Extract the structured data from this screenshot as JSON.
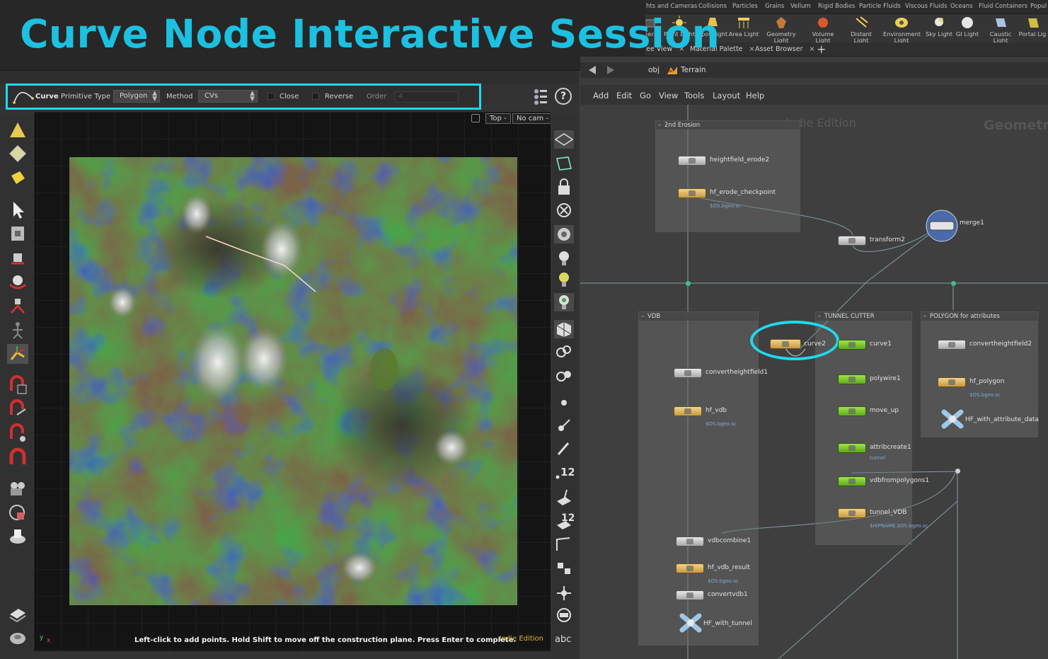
{
  "banner": {
    "title": "Curve Node Interactive Session"
  },
  "shelf": {
    "tabs": [
      "hts and Cameras",
      "Collisions",
      "Particles",
      "Grains",
      "Vellum",
      "Rigid Bodies",
      "Particle Fluids",
      "Viscous Fluids",
      "Oceans",
      "Fluid Containers",
      "Popul"
    ],
    "tools": [
      {
        "label": "mera",
        "icon": "camera-icon"
      },
      {
        "label": "Point Light",
        "icon": "point-light-icon"
      },
      {
        "label": "Spot Light",
        "icon": "spot-light-icon"
      },
      {
        "label": "Area Light",
        "icon": "area-light-icon"
      },
      {
        "label": "Geometry Light",
        "icon": "geometry-light-icon"
      },
      {
        "label": "Volume Light",
        "icon": "volume-light-icon"
      },
      {
        "label": "Distant Light",
        "icon": "distant-light-icon"
      },
      {
        "label": "Environment Light",
        "icon": "environment-light-icon"
      },
      {
        "label": "Sky Light",
        "icon": "sky-light-icon"
      },
      {
        "label": "GI Light",
        "icon": "gi-light-icon"
      },
      {
        "label": "Caustic Light",
        "icon": "caustic-light-icon"
      },
      {
        "label": "Portal Lig",
        "icon": "portal-light-icon"
      }
    ],
    "pane_tabs": [
      "ee View",
      "Material Palette",
      "Asset Browser"
    ],
    "tab_close": "×",
    "add_tab": "+"
  },
  "viewer": {
    "op_toolbar": {
      "node_name": "Curve",
      "primitive_type_label": "Primitive Type",
      "primitive_type_value": "Polygon",
      "method_label": "Method",
      "method_value": "CVs",
      "close_label": "Close",
      "reverse_label": "Reverse",
      "order_label": "Order",
      "order_value": "4",
      "help_label": "?"
    },
    "view_buttons": [
      "Top -",
      "No cam -"
    ],
    "hint": "Left-click to add points. Hold Shift to move off the construction plane. Press Enter to complete.",
    "edition": "Indie Edition",
    "axis_y": "y",
    "axis_x": "x",
    "right_toolbar_numbers": [
      "12",
      "12"
    ],
    "right_toolbar_text": "abc"
  },
  "network": {
    "path": [
      "obj",
      "Terrain"
    ],
    "menus": [
      "Add",
      "Edit",
      "Go",
      "View",
      "Tools",
      "Layout",
      "Help"
    ],
    "watermark": "Indie Edition",
    "context_label": "Geometry",
    "boxes": [
      {
        "id": "erosion",
        "title": "2nd Erosion"
      },
      {
        "id": "vdb",
        "title": "VDB"
      },
      {
        "id": "tunnel",
        "title": "TUNNEL CUTTER"
      },
      {
        "id": "polygon",
        "title": "POLYGON for attributes"
      }
    ],
    "nodes": [
      {
        "name": "heightfield_erode2",
        "sub": ""
      },
      {
        "name": "hf_erode_checkpoint",
        "sub": "$OS.bgeo.sc"
      },
      {
        "name": "transform2",
        "sub": ""
      },
      {
        "name": "merge1",
        "sub": ""
      },
      {
        "name": "curve2",
        "sub": ""
      },
      {
        "name": "convertheightfield1",
        "sub": ""
      },
      {
        "name": "hf_vdb",
        "sub": "$OS.bgeo.sc"
      },
      {
        "name": "vdbcombine1",
        "sub": ""
      },
      {
        "name": "hf_vdb_result",
        "sub": "$OS.bgeo.sc"
      },
      {
        "name": "convertvdb1",
        "sub": ""
      },
      {
        "name": "HF_with_tunnel",
        "sub": ""
      },
      {
        "name": "curve1",
        "sub": ""
      },
      {
        "name": "polywire1",
        "sub": ""
      },
      {
        "name": "move_up",
        "sub": ""
      },
      {
        "name": "attribcreate1",
        "sub": "tunnel"
      },
      {
        "name": "vdbfrompolygons1",
        "sub": ""
      },
      {
        "name": "tunnel_VDB",
        "sub": "$HIPNAME.$OS.bgeo.sc"
      },
      {
        "name": "convertheightfield2",
        "sub": ""
      },
      {
        "name": "hf_polygon",
        "sub": "$OS.bgeo.sc"
      },
      {
        "name": "HF_with_attribute_data",
        "sub": ""
      }
    ]
  },
  "colors": {
    "accent": "#1cc0e0",
    "highlight": "#1fd9ee",
    "indie": "#d9b53a"
  }
}
